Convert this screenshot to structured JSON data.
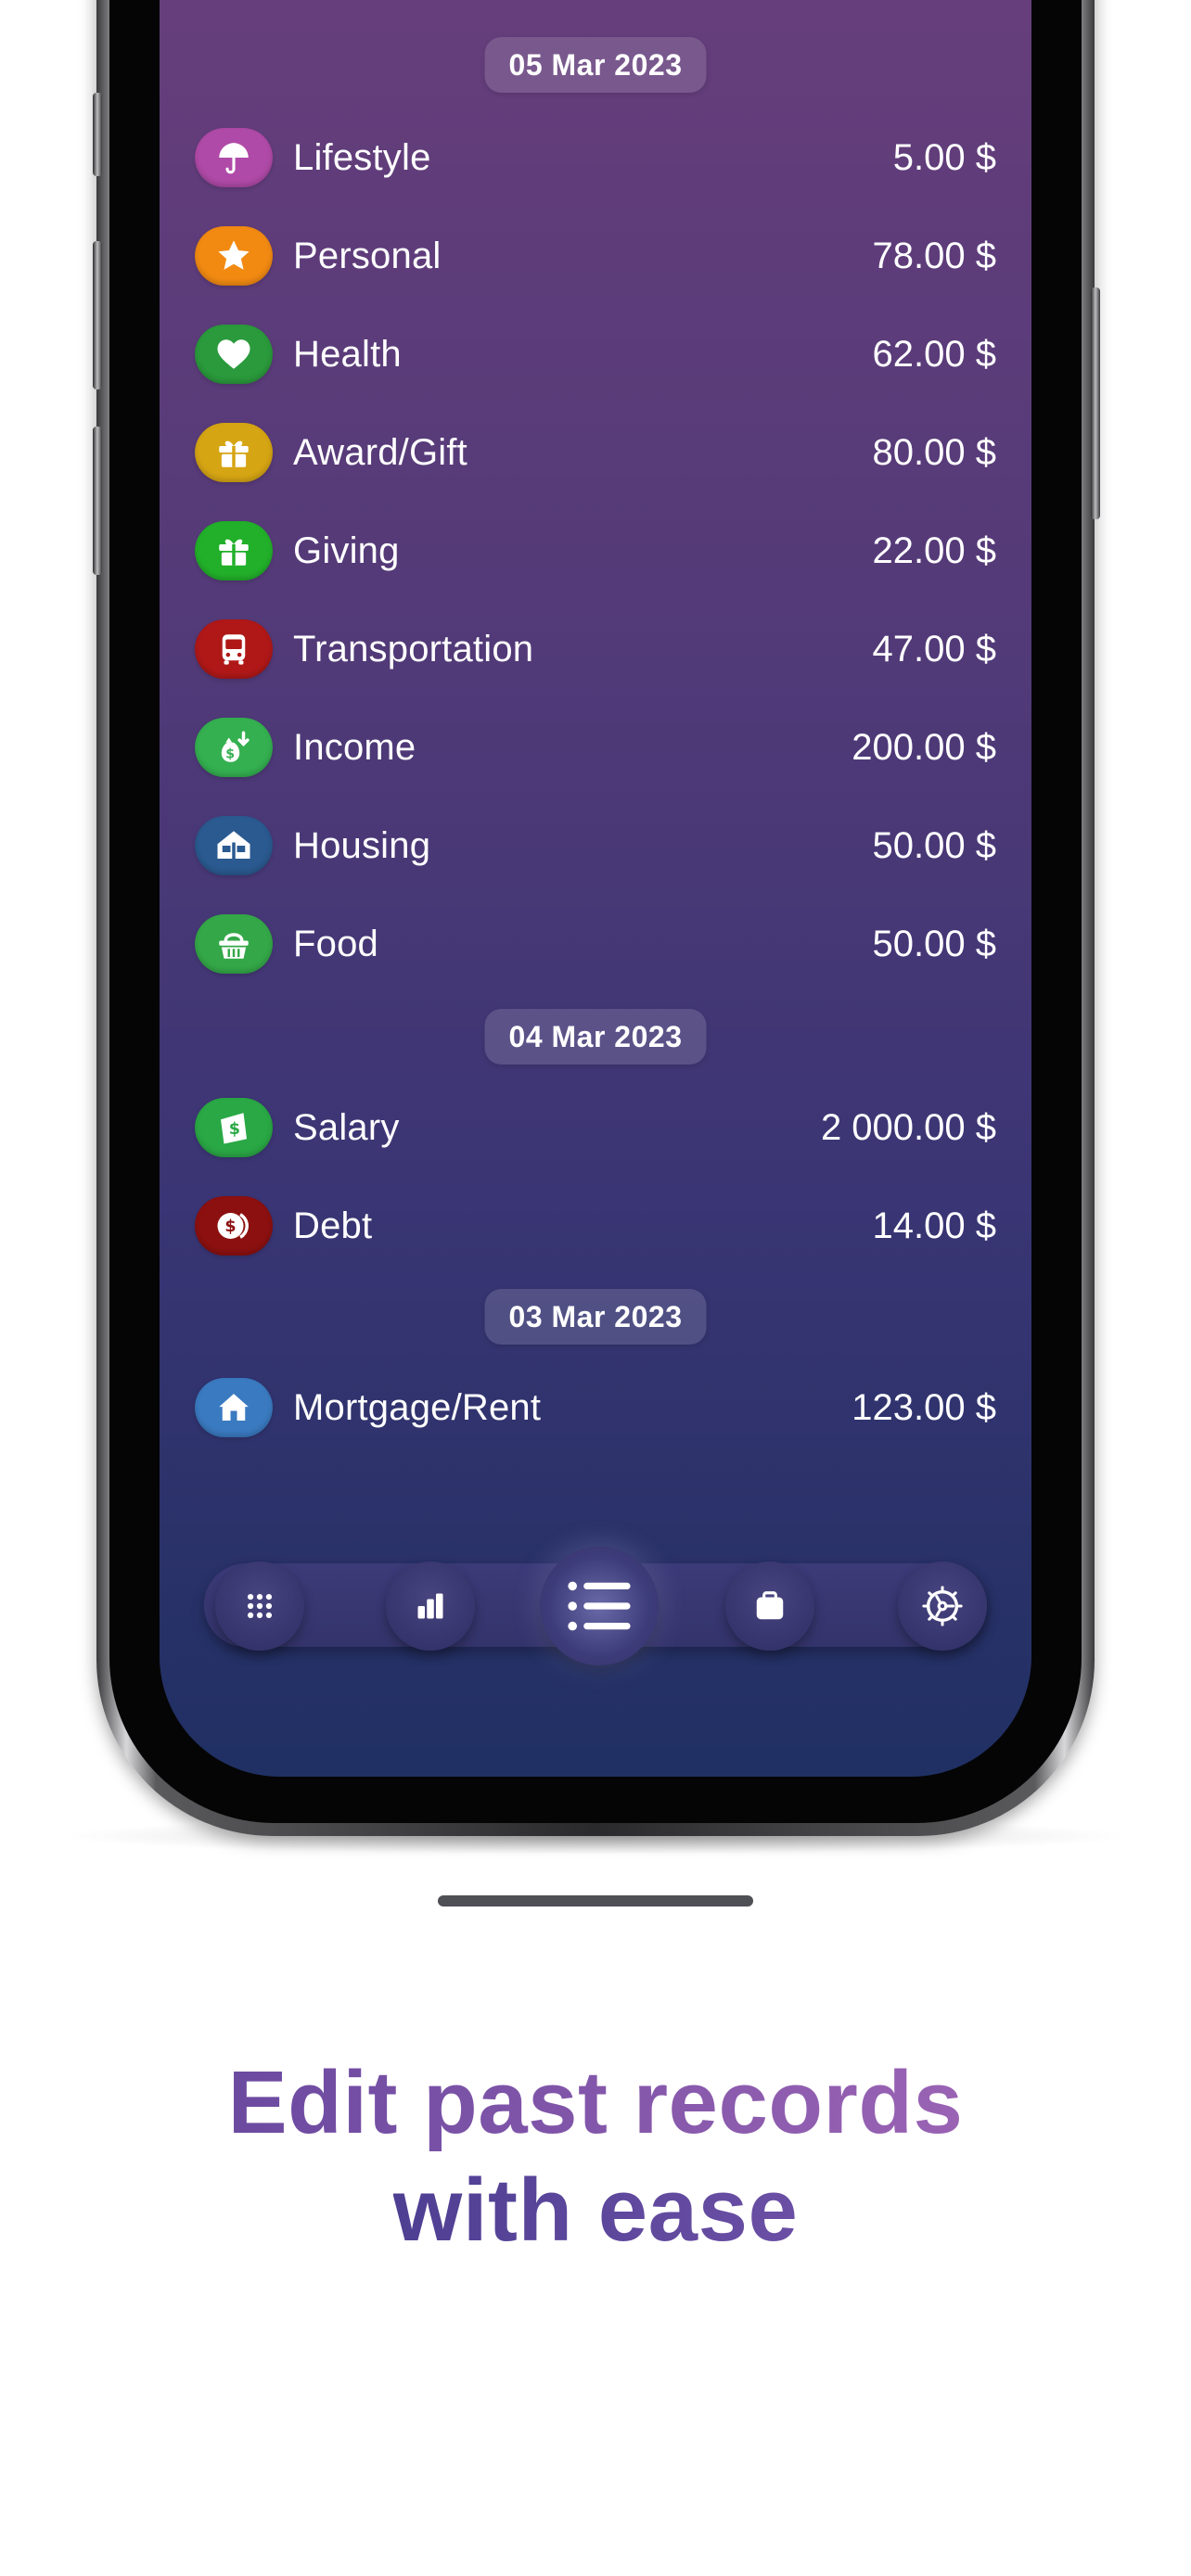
{
  "records": [
    {
      "date": "05 Mar 2023",
      "items": [
        {
          "label": "Lifestyle",
          "amount": "5.00 $",
          "icon": "umbrella-icon",
          "color": "#b04aa8"
        },
        {
          "label": "Personal",
          "amount": "78.00 $",
          "icon": "star-icon",
          "color": "#f28a12"
        },
        {
          "label": "Health",
          "amount": "62.00 $",
          "icon": "heart-icon",
          "color": "#2a9a3c"
        },
        {
          "label": "Award/Gift",
          "amount": "80.00 $",
          "icon": "gift-icon",
          "color": "#d6a514"
        },
        {
          "label": "Giving",
          "amount": "22.00 $",
          "icon": "gift-icon",
          "color": "#22b02a"
        },
        {
          "label": "Transportation",
          "amount": "47.00 $",
          "icon": "bus-icon",
          "color": "#b01818"
        },
        {
          "label": "Income",
          "amount": "200.00 $",
          "icon": "money-bag-icon",
          "color": "#34b050"
        },
        {
          "label": "Housing",
          "amount": "50.00 $",
          "icon": "houses-icon",
          "color": "#2a5a90"
        },
        {
          "label": "Food",
          "amount": "50.00 $",
          "icon": "basket-icon",
          "color": "#34a848"
        }
      ]
    },
    {
      "date": "04 Mar 2023",
      "items": [
        {
          "label": "Salary",
          "amount": "2 000.00 $",
          "icon": "banknote-icon",
          "color": "#2aa845"
        },
        {
          "label": "Debt",
          "amount": "14.00 $",
          "icon": "coins-icon",
          "color": "#8c1010"
        }
      ]
    },
    {
      "date": "03 Mar 2023",
      "items": [
        {
          "label": "Mortgage/Rent",
          "amount": "123.00 $",
          "icon": "home-icon",
          "color": "#3a7ac0"
        }
      ]
    }
  ],
  "tabbar": {
    "tabs": [
      {
        "name": "dashboard",
        "icon": "grid-dots-icon"
      },
      {
        "name": "stats",
        "icon": "bar-chart-icon"
      },
      {
        "name": "records",
        "icon": "list-icon",
        "active": true
      },
      {
        "name": "budget",
        "icon": "briefcase-icon"
      },
      {
        "name": "settings",
        "icon": "gear-icon"
      }
    ]
  },
  "headline": {
    "line1": "Edit past records",
    "line2": "with ease"
  }
}
